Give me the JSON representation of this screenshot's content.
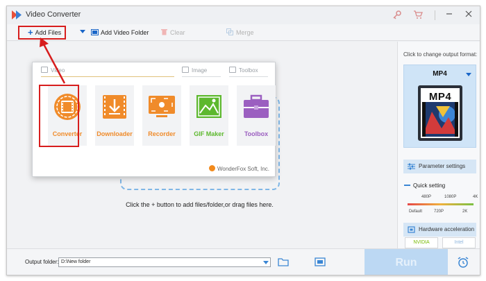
{
  "window": {
    "title": "Video Converter"
  },
  "toolbar": {
    "add_files": "Add Files",
    "add_video_folder": "Add Video Folder",
    "clear": "Clear",
    "merge": "Merge"
  },
  "popup": {
    "categories": {
      "video": "Video",
      "image": "Image",
      "toolbox": "Toolbox"
    },
    "tiles": [
      {
        "label": "Converter",
        "color": "#f08b2a"
      },
      {
        "label": "Downloader",
        "color": "#f08b2a"
      },
      {
        "label": "Recorder",
        "color": "#f08b2a"
      },
      {
        "label": "GIF Maker",
        "color": "#5db82e"
      },
      {
        "label": "Toolbox",
        "color": "#9b5fc0"
      }
    ],
    "brand": "WonderFox Soft, Inc."
  },
  "main": {
    "hint": "Click the + button to add files/folder,or drag files here."
  },
  "right_panel": {
    "caption": "Click to change output format:",
    "format": "MP4",
    "format_icon_text": "MP4",
    "parameter_settings": "Parameter settings",
    "quick_setting": "Quick setting",
    "resolutions_top": [
      "480P",
      "1080P",
      "4K"
    ],
    "resolutions_bottom": [
      "Default",
      "720P",
      "2K"
    ],
    "hardware_acceleration": "Hardware acceleration",
    "gpu_options": [
      "NVIDIA",
      "Intel"
    ]
  },
  "bottom": {
    "output_folder_label": "Output folder:",
    "output_folder_value": "D:\\New folder",
    "run": "Run"
  },
  "colors": {
    "accent": "#1a66c8",
    "highlight": "#d71d1d",
    "run": "#bcd8f3"
  }
}
